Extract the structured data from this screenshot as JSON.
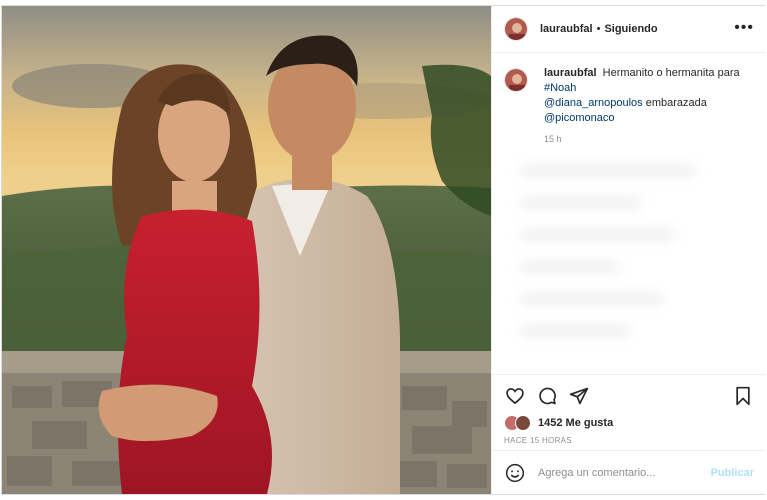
{
  "colors": {
    "accent_link": "#00376b",
    "publish_disabled": "#b2dffc",
    "text_primary": "#262626",
    "text_secondary": "#8e8e8e"
  },
  "post_header": {
    "username": "lauraubfal",
    "separator": "•",
    "follow_status": "Siguiendo",
    "more_icon": "more-horizontal-icon"
  },
  "caption": {
    "username": "lauraubfal",
    "text_1": "Hermanito o hermanita para",
    "hashtag": "#Noah",
    "mention_1": "@diana_arnopoulos",
    "text_2": "embarazada",
    "mention_2": "@picomonaco",
    "time": "15 h"
  },
  "actions": {
    "like_icon": "heart-icon",
    "comment_icon": "comment-icon",
    "share_icon": "paper-plane-icon",
    "save_icon": "bookmark-icon"
  },
  "likes": {
    "count_text": "1452 Me gusta"
  },
  "time_ago": "HACE 15 HORAS",
  "comment_box": {
    "emoji_icon": "smiley-icon",
    "placeholder": "Agrega un comentario...",
    "publish_label": "Publicar"
  },
  "photo": {
    "description_icon": "post-photo"
  }
}
